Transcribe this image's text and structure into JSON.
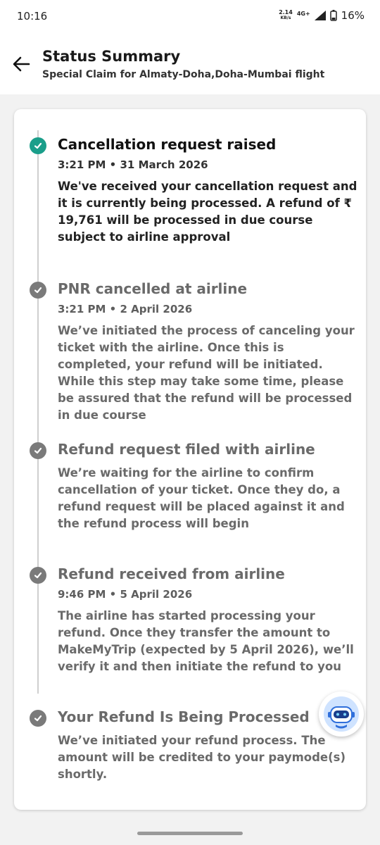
{
  "status_bar": {
    "time": "10:16",
    "net_speed": "2.14",
    "net_unit": "KB/s",
    "network": "4G+",
    "battery": "16%"
  },
  "header": {
    "title": "Status Summary",
    "subtitle": "Special Claim for Almaty-Doha,Doha-Mumbai flight",
    "back_icon": "back-arrow-icon"
  },
  "steps": [
    {
      "title": "Cancellation request raised",
      "time": "3:21 PM • 31 March 2026",
      "description": "We've received your cancellation request and it is currently being processed. A refund of ₹ 19,761 will be processed in due course subject to airline approval",
      "state": "done"
    },
    {
      "title": "PNR cancelled at airline",
      "time": "3:21 PM • 2 April 2026",
      "description": "We’ve initiated the process of canceling your ticket with the airline. Once this is completed, your refund will be initiated. While this step may take some time, please be assured that the refund will be processed in due course",
      "state": "pending"
    },
    {
      "title": "Refund request filed with airline",
      "time": "",
      "description": "We’re waiting for the airline to confirm cancellation of your ticket. Once they do, a refund request will be placed against it and the refund process will begin",
      "state": "pending"
    },
    {
      "title": "Refund received from airline",
      "time": "9:46 PM • 5 April 2026",
      "description": "The airline has started processing your refund. Once they transfer the amount to MakeMyTrip (expected by 5 April 2026), we’ll verify it and then initiate the refund to you",
      "state": "pending"
    },
    {
      "title": "Your Refund Is Being Processed",
      "time": "",
      "description": "We’ve initiated your refund process. The amount will be credited to your paymode(s) shortly.",
      "state": "pending"
    }
  ],
  "colors": {
    "done": "#1a9e8a",
    "pending": "#7a7a7a"
  },
  "chat_fab_icon": "chatbot-icon"
}
